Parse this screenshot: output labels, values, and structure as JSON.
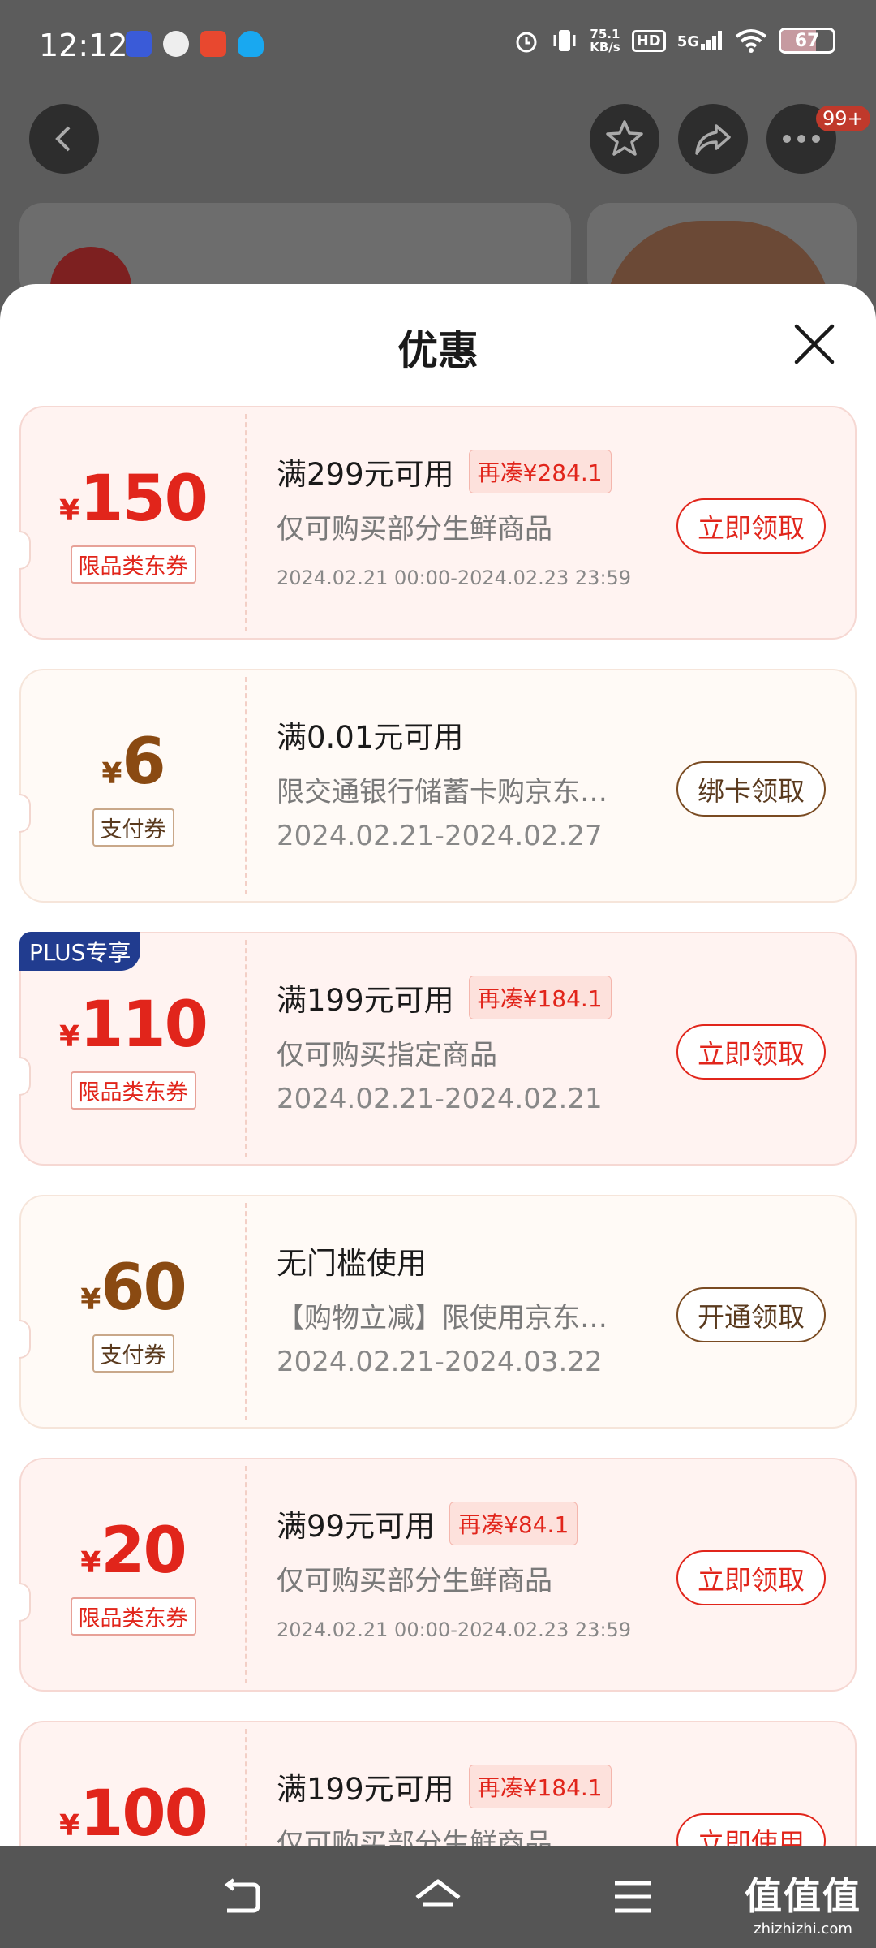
{
  "status_bar": {
    "time": "12:12",
    "net_speed_value": "75.1",
    "net_speed_unit": "KB/s",
    "hd": "HD",
    "signal": "5G",
    "battery": "67",
    "battery_level": 0.67,
    "app_icons": [
      "tieba-icon",
      "weibo-icon",
      "manhua-icon",
      "qq-icon"
    ]
  },
  "header": {
    "notification_badge": "99+"
  },
  "sheet": {
    "title": "优惠",
    "coupons": [
      {
        "style": "red",
        "currency": "¥",
        "amount": "150",
        "tag": "限品类东券",
        "condition": "满299元可用",
        "extra": "再凑¥284.1",
        "desc": "仅可购买部分生鲜商品",
        "date": "2024.02.21 00:00-2024.02.23 23:59",
        "button": "立即领取"
      },
      {
        "style": "brown",
        "currency": "¥",
        "amount": "6",
        "tag": "支付券",
        "condition": "满0.01元可用",
        "desc": "限交通银行储蓄卡购京东…",
        "date": "2024.02.21-2024.02.27",
        "button": "绑卡领取"
      },
      {
        "style": "red",
        "badge": "PLUS专享",
        "currency": "¥",
        "amount": "110",
        "tag": "限品类东券",
        "condition": "满199元可用",
        "extra": "再凑¥184.1",
        "desc": "仅可购买指定商品",
        "date": "2024.02.21-2024.02.21",
        "button": "立即领取"
      },
      {
        "style": "brown",
        "currency": "¥",
        "amount": "60",
        "tag": "支付券",
        "condition": "无门槛使用",
        "desc": "【购物立减】限使用京东…",
        "date": "2024.02.21-2024.03.22",
        "button": "开通领取"
      },
      {
        "style": "red",
        "currency": "¥",
        "amount": "20",
        "tag": "限品类东券",
        "condition": "满99元可用",
        "extra": "再凑¥84.1",
        "desc": "仅可购买部分生鲜商品",
        "date": "2024.02.21 00:00-2024.02.23 23:59",
        "button": "立即领取"
      },
      {
        "style": "red",
        "currency": "¥",
        "amount": "100",
        "condition": "满199元可用",
        "extra": "再凑¥184.1",
        "desc": "仅可购买部分生鲜商品",
        "button": "立即使用"
      }
    ]
  },
  "watermark": {
    "text": "值值值",
    "domain": "zhizhizhi.com"
  },
  "colors": {
    "accent_red": "#e1251b",
    "accent_brown": "#8a4a12",
    "overlay": "#5c5c5c"
  }
}
